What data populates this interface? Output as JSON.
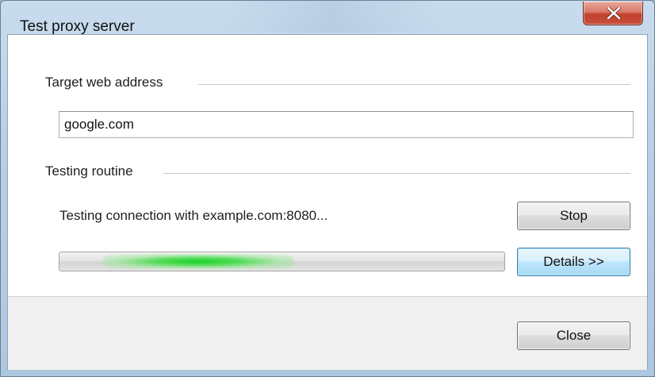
{
  "window": {
    "title": "Test proxy server"
  },
  "target_group": {
    "label": "Target web address",
    "input_value": "google.com"
  },
  "testing_group": {
    "label": "Testing routine",
    "status": "Testing connection with example.com:8080...",
    "stop_label": "Stop",
    "details_label": "Details >>",
    "progress_indeterminate": true
  },
  "footer": {
    "close_label": "Close"
  },
  "icons": {
    "title_close": "close-icon"
  },
  "colors": {
    "progress_glow": "#1ad028",
    "close_button": "#c0412f",
    "default_button_border": "#3c7fb1"
  }
}
